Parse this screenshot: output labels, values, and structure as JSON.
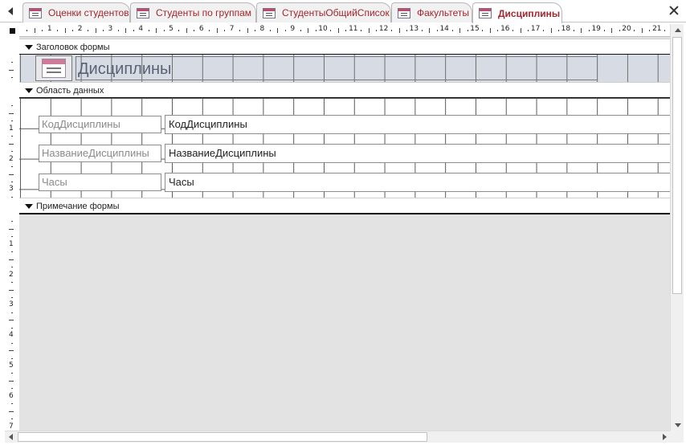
{
  "tabs": [
    {
      "label": "Оценки студентов",
      "active": false
    },
    {
      "label": "Студенты по группам",
      "active": false
    },
    {
      "label": "СтудентыОбщийСписок",
      "active": false
    },
    {
      "label": "Факультеты",
      "active": false
    },
    {
      "label": "Дисциплины",
      "active": true
    }
  ],
  "icons": {
    "tab_form": "form-icon",
    "scroll_tabs": "chevron-left-icon",
    "close": "close-icon",
    "band_toggle": "triangle-down-icon"
  },
  "ruler": {
    "horizontal": [
      "1",
      "2",
      "3",
      "4",
      "5",
      "6",
      "7",
      "8",
      "9",
      "10",
      "11",
      "12",
      "13",
      "14",
      "15",
      "16",
      "17",
      "18",
      "19",
      "20",
      "21"
    ],
    "vertical": [
      "1",
      "2",
      "3",
      "1",
      "2",
      "3",
      "4",
      "5",
      "6",
      "7"
    ]
  },
  "sections": {
    "header": "Заголовок формы",
    "detail": "Область данных",
    "footer": "Примечание формы"
  },
  "form_title": "Дисциплины",
  "fields": [
    {
      "label": "КодДисциплины",
      "control": "КодДисциплины"
    },
    {
      "label": "НазваниеДисциплины",
      "control": "НазваниеДисциплины"
    },
    {
      "label": "Часы",
      "control": "Часы"
    }
  ],
  "colors": {
    "tab_text": "#a4262c",
    "header_section": "#d6dbe4",
    "canvas": "#e3e3e3"
  }
}
